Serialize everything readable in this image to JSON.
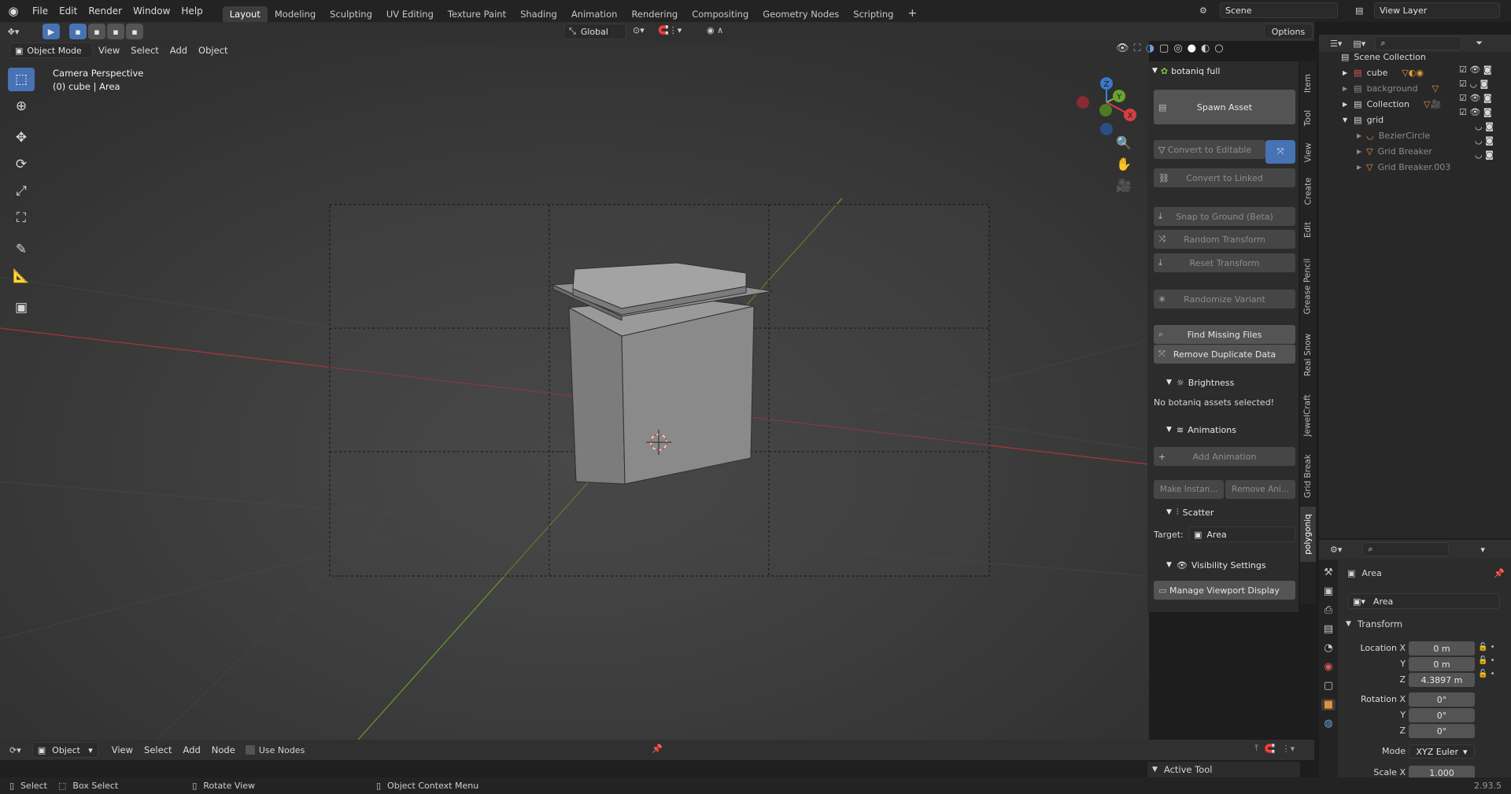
{
  "menu": {
    "items": [
      "File",
      "Edit",
      "Render",
      "Window",
      "Help"
    ]
  },
  "workspaces": [
    "Layout",
    "Modeling",
    "Sculpting",
    "UV Editing",
    "Texture Paint",
    "Shading",
    "Animation",
    "Rendering",
    "Compositing",
    "Geometry Nodes",
    "Scripting"
  ],
  "active_workspace": "Layout",
  "scene": {
    "name": "Scene",
    "view_layer": "View Layer"
  },
  "viewport_header": {
    "transform_orientation": "Global",
    "options_label": "Options"
  },
  "viewport_header2": {
    "mode": "Object Mode",
    "items": [
      "View",
      "Select",
      "Add",
      "Object"
    ]
  },
  "viewport_overlay": {
    "camera": "Camera Perspective",
    "selection": "(0) cube | Area"
  },
  "npanel": {
    "addon_title": "botaniq full",
    "spawn_asset": "Spawn Asset",
    "convert_editable": "Convert to Editable",
    "convert_linked": "Convert to Linked",
    "snap_ground": "Snap to Ground (Beta)",
    "random_transform": "Random Transform",
    "reset_transform": "Reset Transform",
    "randomize_variant": "Randomize Variant",
    "find_missing": "Find Missing Files",
    "remove_duplicate": "Remove Duplicate Data",
    "brightness_header": "Brightness",
    "no_assets": "No botaniq assets selected!",
    "animations_header": "Animations",
    "add_animation": "Add Animation",
    "make_instance": "Make Instan...",
    "remove_anim": "Remove Ani...",
    "scatter_header": "Scatter",
    "target_label": "Target:",
    "target_value": "Area",
    "visibility_header": "Visibility Settings",
    "manage_viewport": "Manage Viewport Display",
    "active_tool": "Active Tool"
  },
  "vertical_tabs": [
    "Item",
    "Tool",
    "View",
    "Create",
    "Edit",
    "Grease Pencil",
    "Real Snow",
    "JewelCraft",
    "Grid Break",
    "polygoniq"
  ],
  "outliner": {
    "root": "Scene Collection",
    "items": [
      {
        "name": "cube",
        "indent": 1
      },
      {
        "name": "background",
        "indent": 1
      },
      {
        "name": "Collection",
        "indent": 1
      },
      {
        "name": "grid",
        "indent": 1
      },
      {
        "name": "BezierCircle",
        "indent": 2
      },
      {
        "name": "Grid Breaker",
        "indent": 2
      },
      {
        "name": "Grid Breaker.003",
        "indent": 2
      }
    ]
  },
  "properties": {
    "object_name": "Area",
    "object_data": "Area",
    "transform_header": "Transform",
    "location_x_label": "Location X",
    "location_x": "0 m",
    "location_y_label": "Y",
    "location_y": "0 m",
    "location_z_label": "Z",
    "location_z": "4.3897 m",
    "rotation_x_label": "Rotation X",
    "rotation_x": "0°",
    "rotation_y_label": "Y",
    "rotation_y": "0°",
    "rotation_z_label": "Z",
    "rotation_z": "0°",
    "mode_label": "Mode",
    "mode_value": "XYZ Euler",
    "scale_x_label": "Scale X",
    "scale_x": "1.000"
  },
  "node_header": {
    "object_label": "Object",
    "items": [
      "View",
      "Select",
      "Add",
      "Node"
    ],
    "use_nodes": "Use Nodes"
  },
  "status_bar": {
    "select": "Select",
    "box_select": "Box Select",
    "rotate_view": "Rotate View",
    "context_menu": "Object Context Menu",
    "version": "2.93.5"
  },
  "colors": {
    "accent": "#4772b3",
    "x_axis": "#a8353d",
    "y_axis": "#6b9a2a",
    "z_axis": "#3a78c8"
  }
}
